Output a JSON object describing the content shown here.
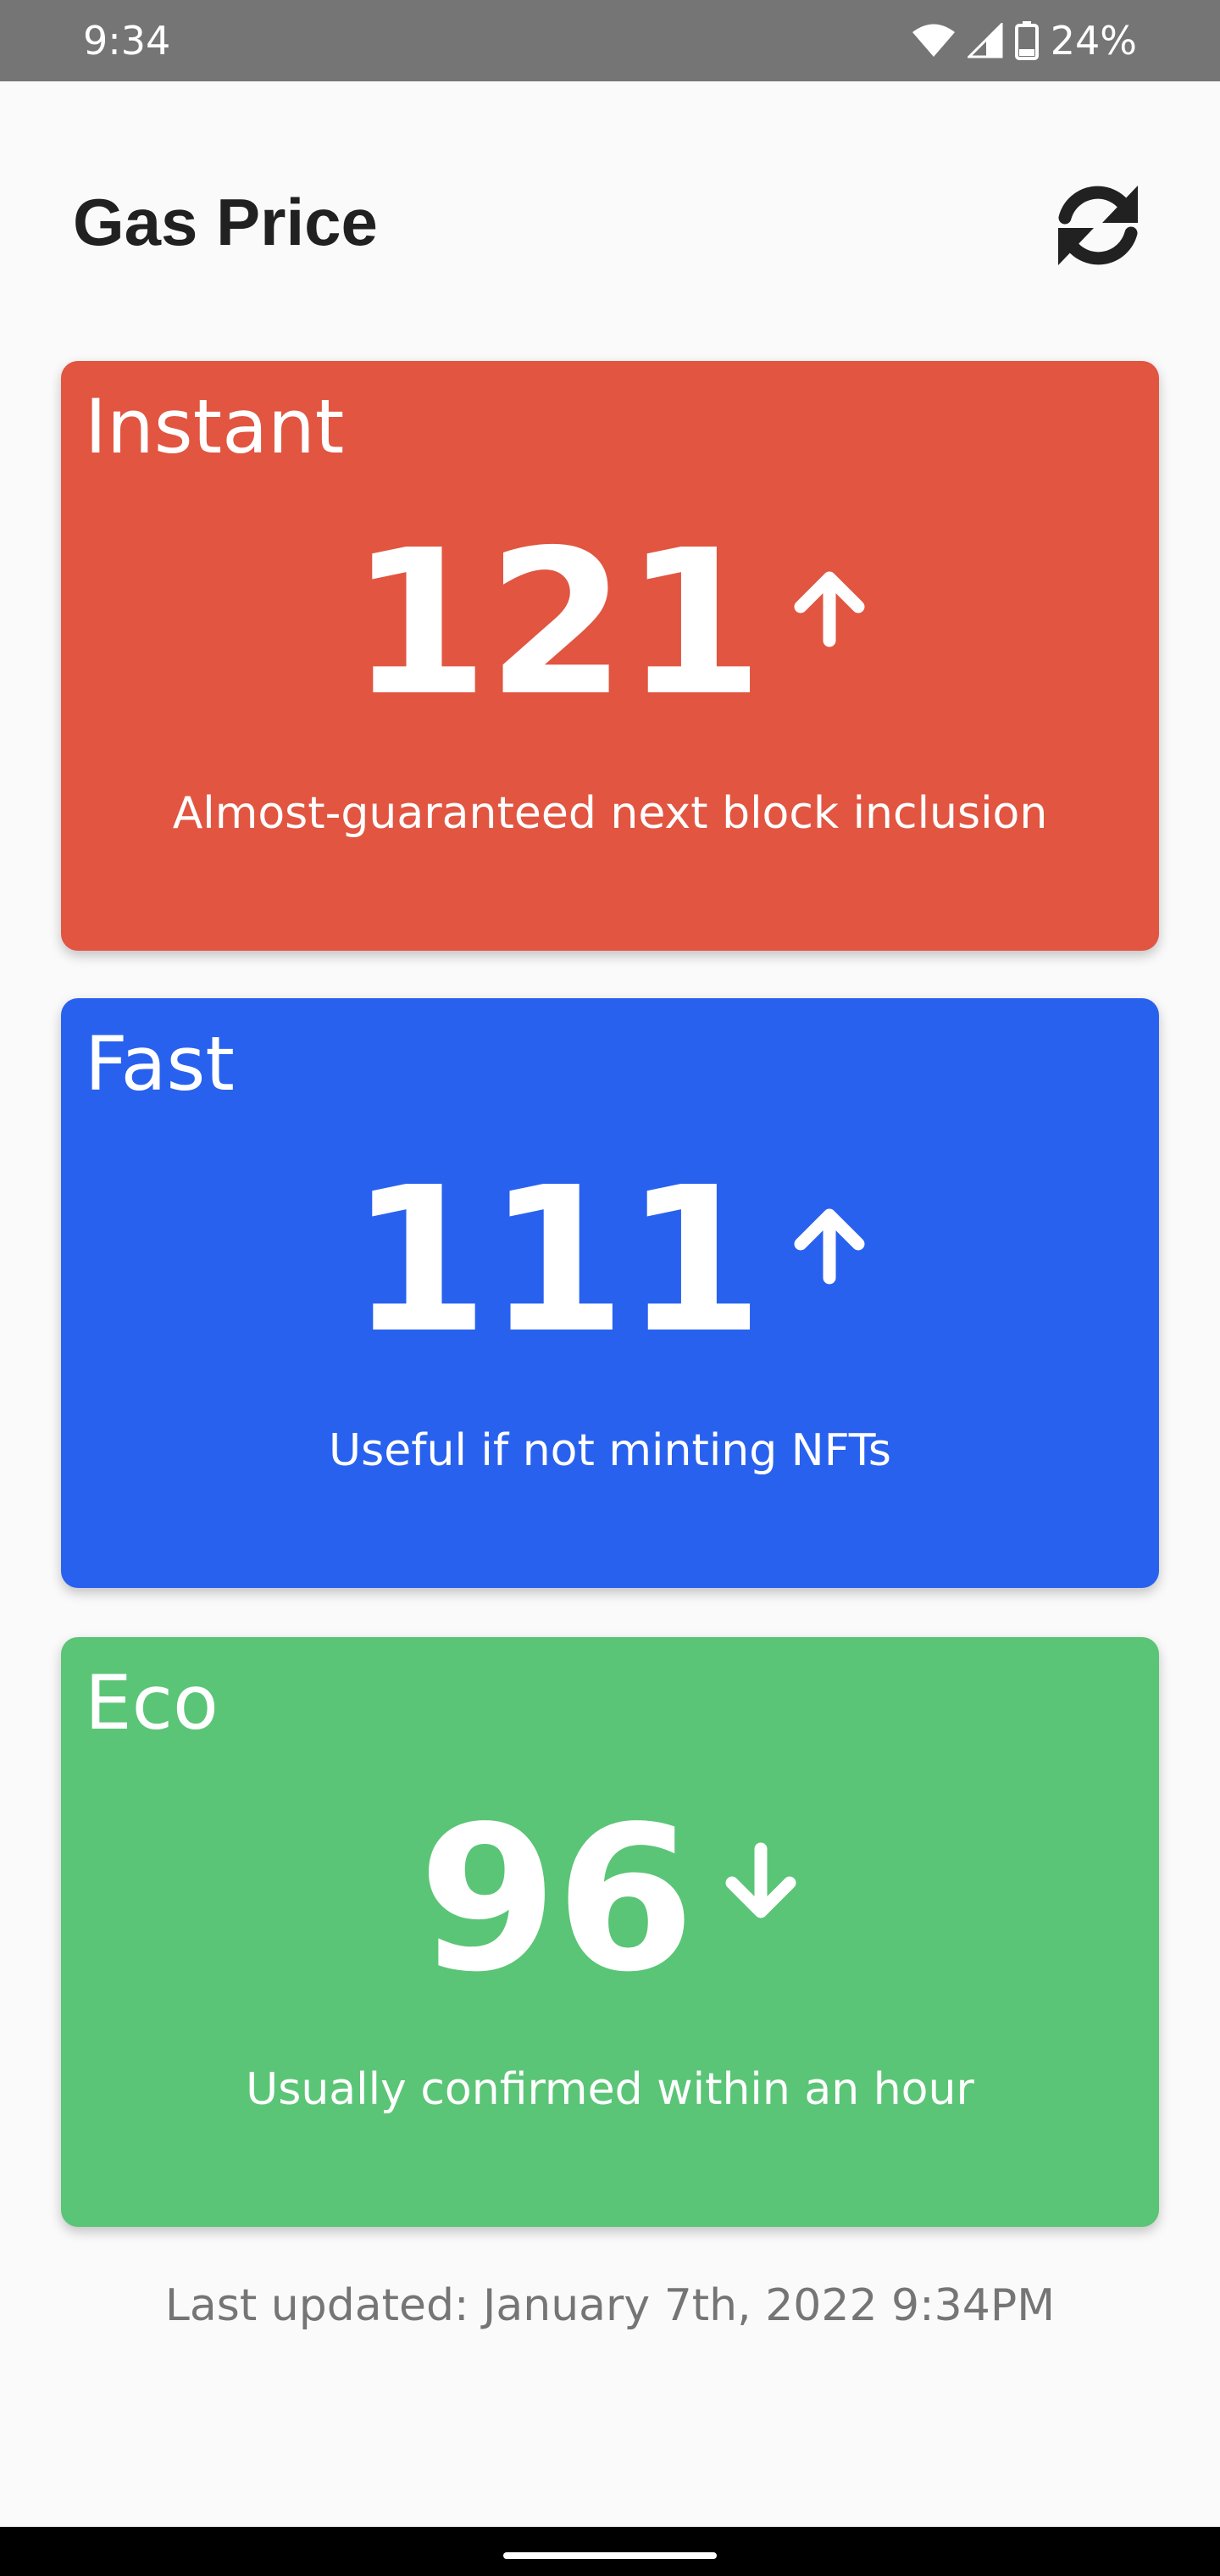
{
  "status_bar": {
    "time": "9:34",
    "battery": "24%",
    "icons": [
      "wifi-icon",
      "signal-icon",
      "battery-icon"
    ]
  },
  "header": {
    "title": "Gas Price",
    "refresh_icon": "refresh-icon"
  },
  "cards": [
    {
      "label": "Instant",
      "value": "121",
      "trend": "up",
      "trend_icon": "arrow-up-icon",
      "description": "Almost-guaranteed next block inclusion",
      "color": "#e15541"
    },
    {
      "label": "Fast",
      "value": "111",
      "trend": "up",
      "trend_icon": "arrow-up-icon",
      "description": "Useful if not minting NFTs",
      "color": "#2961ef"
    },
    {
      "label": "Eco",
      "value": "96",
      "trend": "down",
      "trend_icon": "arrow-down-icon",
      "description": "Usually confirmed within an hour",
      "color": "#5ac576"
    }
  ],
  "footer": {
    "last_updated": "Last updated: January 7th, 2022 9:34PM"
  }
}
